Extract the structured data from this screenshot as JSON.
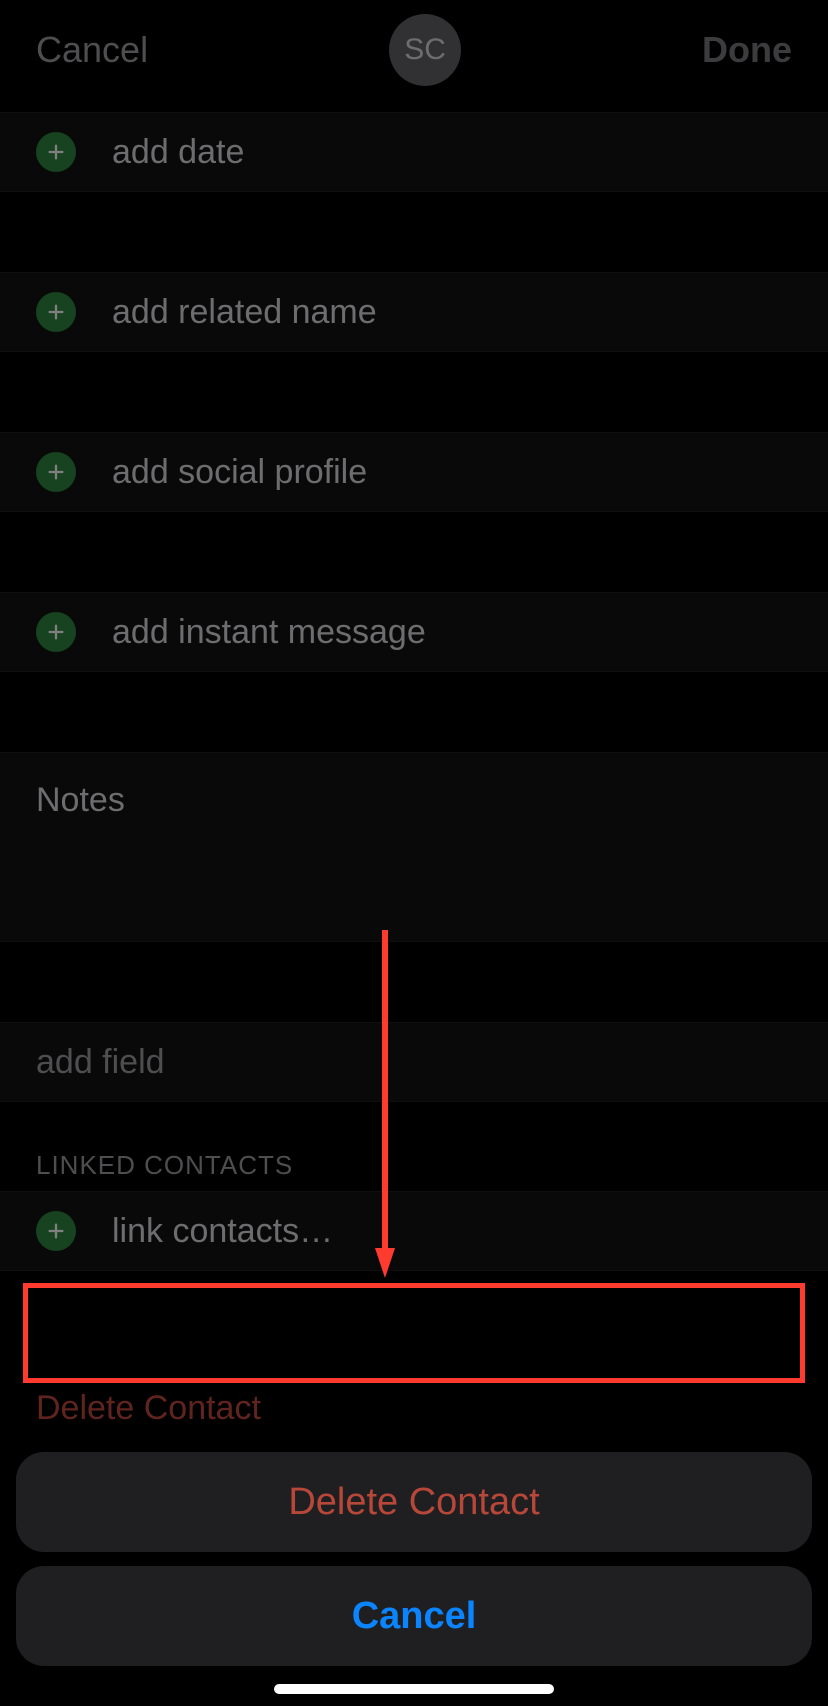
{
  "nav": {
    "cancel": "Cancel",
    "done": "Done",
    "avatar_initials": "SC"
  },
  "rows": {
    "add_date": "add date",
    "add_related_name": "add related name",
    "add_social_profile": "add social profile",
    "add_instant_message": "add instant message",
    "notes": "Notes",
    "add_field": "add field",
    "link_contacts": "link contacts…"
  },
  "section": {
    "linked_contacts": "LINKED CONTACTS"
  },
  "delete_row": "Delete Contact",
  "sheet": {
    "delete": "Delete Contact",
    "cancel": "Cancel"
  }
}
